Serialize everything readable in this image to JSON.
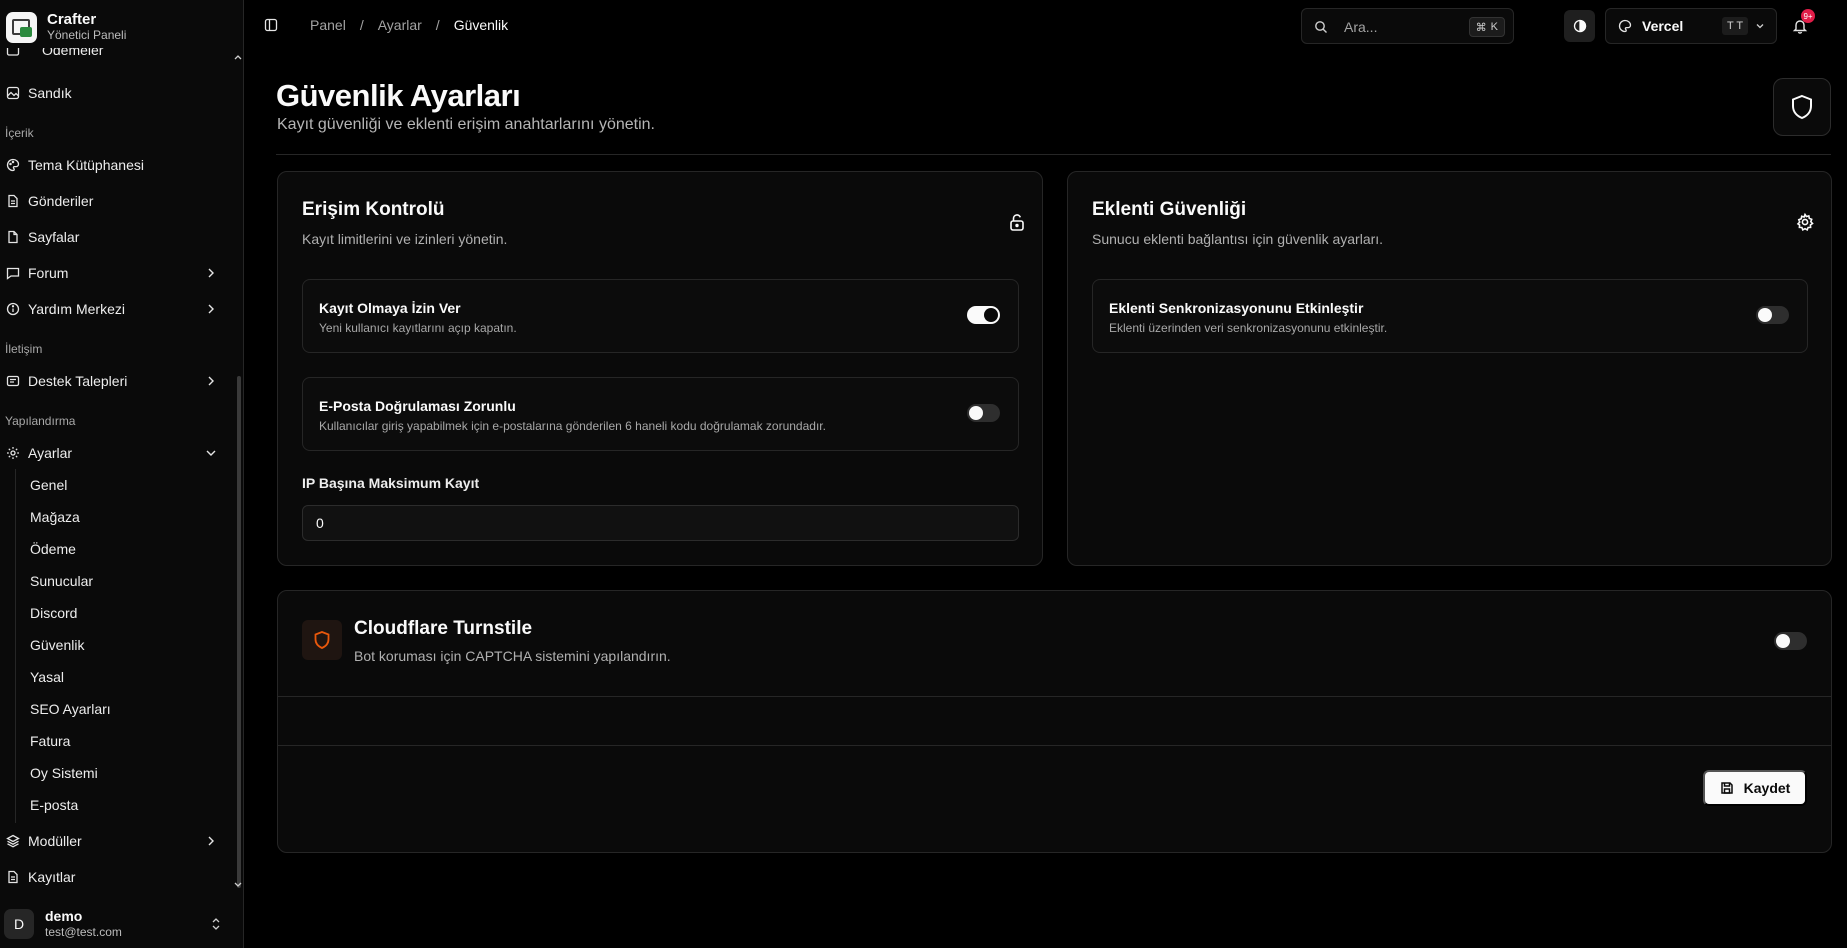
{
  "brand": {
    "name": "Crafter",
    "subtitle": "Yönetici Paneli"
  },
  "sidebar": {
    "partial_top_item": "Ödemeler",
    "items": {
      "sandik": "Sandık",
      "tema": "Tema Kütüphanesi",
      "gonderiler": "Gönderiler",
      "sayfalar": "Sayfalar",
      "forum": "Forum",
      "yardim": "Yardım Merkezi",
      "destek": "Destek Talepleri",
      "ayarlar": "Ayarlar",
      "moduller": "Modüller",
      "kayitlar": "Kayıtlar"
    },
    "groups": {
      "icerik": "İçerik",
      "iletisim": "İletişim",
      "yapilandirma": "Yapılandırma"
    },
    "settings_sub": [
      "Genel",
      "Mağaza",
      "Ödeme",
      "Sunucular",
      "Discord",
      "Güvenlik",
      "Yasal",
      "SEO Ayarları",
      "Fatura",
      "Oy Sistemi",
      "E-posta"
    ]
  },
  "user": {
    "initial": "D",
    "name": "demo",
    "email": "test@test.com"
  },
  "header": {
    "breadcrumbs": [
      "Panel",
      "Ayarlar",
      "Güvenlik"
    ],
    "search_placeholder": "Ara...",
    "search_shortcut_symbol": "⌘",
    "search_shortcut_key": "K",
    "tenant": "Vercel",
    "tenant_badge": "T T",
    "notifications": "9+"
  },
  "page": {
    "title": "Güvenlik Ayarları",
    "subtitle": "Kayıt güvenliği ve eklenti erişim anahtarlarını yönetin."
  },
  "access_card": {
    "title": "Erişim Kontrolü",
    "subtitle": "Kayıt limitlerini ve izinleri yönetin.",
    "allow_registration": {
      "label": "Kayıt Olmaya İzin Ver",
      "desc": "Yeni kullanıcı kayıtlarını açıp kapatın.",
      "enabled": true
    },
    "email_verification": {
      "label": "E-Posta Doğrulaması Zorunlu",
      "desc": "Kullanıcılar giriş yapabilmek için e-postalarına gönderilen 6 haneli kodu doğrulamak zorundadır.",
      "enabled": false
    },
    "max_per_ip": {
      "label": "IP Başına Maksimum Kayıt",
      "value": "0"
    }
  },
  "plugin_card": {
    "title": "Eklenti Güvenliği",
    "subtitle": "Sunucu eklenti bağlantısı için güvenlik ayarları.",
    "sync": {
      "label": "Eklenti Senkronizasyonunu Etkinleştir",
      "desc": "Eklenti üzerinden veri senkronizasyonunu etkinleştir.",
      "enabled": false
    }
  },
  "turnstile": {
    "title": "Cloudflare Turnstile",
    "subtitle": "Bot koruması için CAPTCHA sistemini yapılandırın.",
    "enabled": false
  },
  "actions": {
    "save_label": "Kaydet"
  },
  "colors": {
    "background": "#000000",
    "card": "#0a0a0a",
    "border": "#262626",
    "accent_orange": "#ea580c",
    "badge": "#e11d48"
  }
}
